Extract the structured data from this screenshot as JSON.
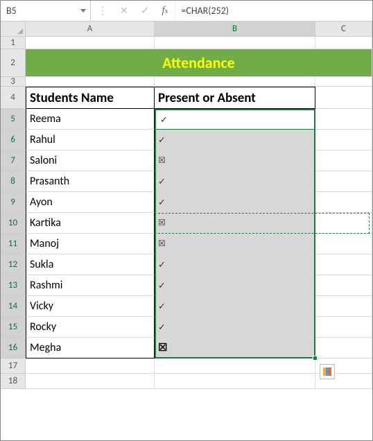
{
  "cell_ref": "B5",
  "formula": "=CHAR(252)",
  "columns": {
    "A": "A",
    "B": "B",
    "C": "C"
  },
  "banner": "Attendance",
  "headers": {
    "name": "Students Name",
    "status": "Present or Absent"
  },
  "rows": [
    {
      "n": "5",
      "name": "Reema",
      "mark": "✓",
      "big": false
    },
    {
      "n": "6",
      "name": "Rahul",
      "mark": "✓",
      "big": false
    },
    {
      "n": "7",
      "name": "Saloni",
      "mark": "☒",
      "big": false
    },
    {
      "n": "8",
      "name": "Prasanth",
      "mark": "✓",
      "big": false
    },
    {
      "n": "9",
      "name": "Ayon",
      "mark": "✓",
      "big": false
    },
    {
      "n": "10",
      "name": "Kartika",
      "mark": "☒",
      "big": false
    },
    {
      "n": "11",
      "name": "Manoj",
      "mark": "☒",
      "big": false
    },
    {
      "n": "12",
      "name": "Sukla",
      "mark": "✓",
      "big": false
    },
    {
      "n": "13",
      "name": "Rashmi",
      "mark": "✓",
      "big": false
    },
    {
      "n": "14",
      "name": "Vicky",
      "mark": "✓",
      "big": false
    },
    {
      "n": "15",
      "name": "Rocky",
      "mark": "✓",
      "big": false
    },
    {
      "n": "16",
      "name": "Megha",
      "mark": "☒",
      "big": true
    }
  ],
  "rownums": {
    "r1": "1",
    "r2": "2",
    "r3": "3",
    "r4": "4",
    "r17": "17",
    "r18": "18"
  }
}
